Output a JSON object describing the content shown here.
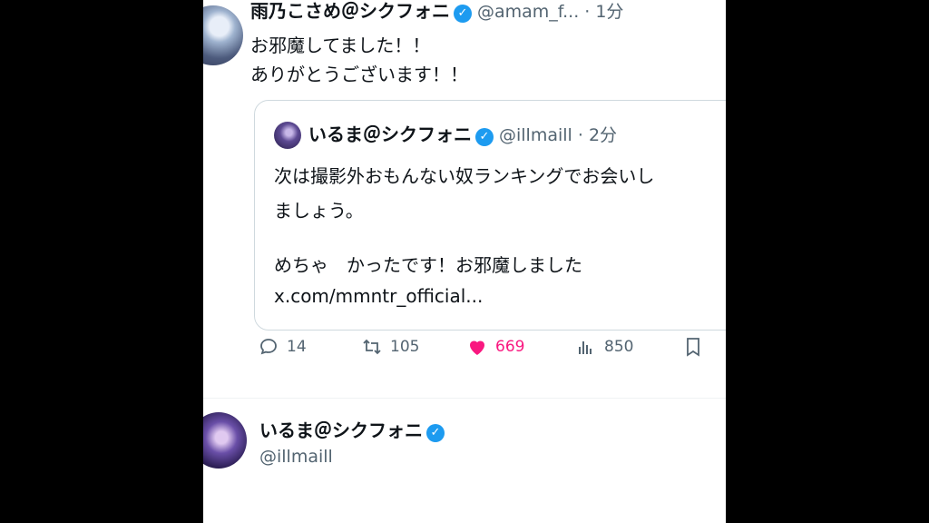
{
  "post": {
    "author_name": "雨乃こさめ＠シクフォニ",
    "handle_time": "@amam_f... · 1分",
    "lines": [
      "お邪魔してました！！",
      "ありがとうございます！！"
    ]
  },
  "quote": {
    "author_name": "いるま＠シクフォニ",
    "handle_time": "@illmaill · 2分",
    "lines": [
      "次は撮影外おもんない奴ランキングでお会いし",
      "ましょう。",
      "めちゃ　かったです！お邪魔しました",
      "x.com/mmntr_official..."
    ]
  },
  "actions": {
    "replies": "14",
    "reposts": "105",
    "likes": "669",
    "views": "850"
  },
  "reply": {
    "author_name": "いるま＠シクフォニ",
    "handle": "@illmaill"
  },
  "colors": {
    "verified": "#1d9bf0",
    "like": "#f91880"
  },
  "icons": [
    "verified-icon",
    "reply-icon",
    "repost-icon",
    "like-icon",
    "views-icon",
    "bookmark-icon"
  ]
}
